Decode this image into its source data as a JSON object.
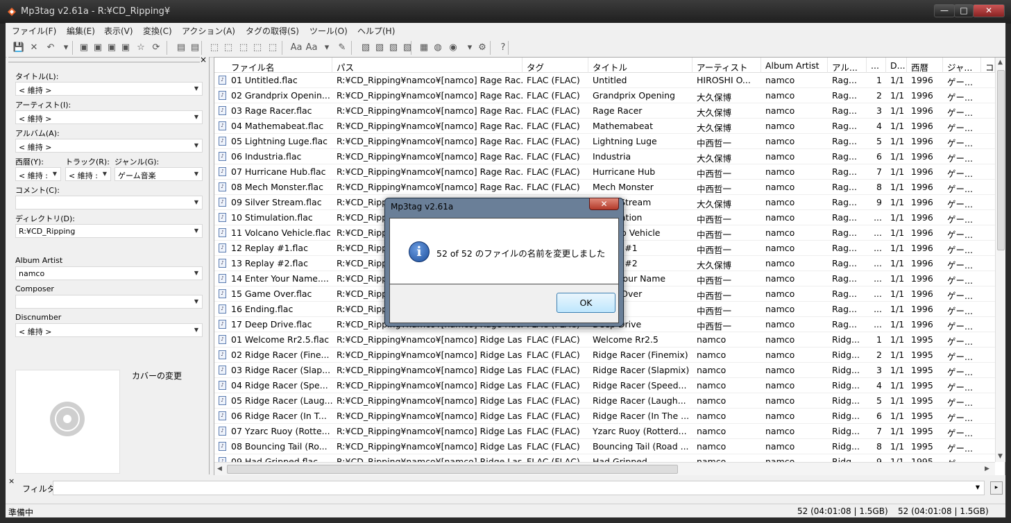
{
  "window": {
    "title": "Mp3tag v2.61a  -  R:¥CD_Ripping¥",
    "btn_min": "—",
    "btn_max": "□",
    "btn_close": "✕"
  },
  "menu": [
    "ファイル(F)",
    "編集(E)",
    "表示(V)",
    "変換(C)",
    "アクション(A)",
    "タグの取得(S)",
    "ツール(O)",
    "ヘルプ(H)"
  ],
  "tag_panel": {
    "close": "×",
    "title_label": "タイトル(L):",
    "title_value": "< 維持 >",
    "artist_label": "アーティスト(I):",
    "artist_value": "< 維持 >",
    "album_label": "アルバム(A):",
    "album_value": "< 維持 >",
    "year_label": "西暦(Y):",
    "year_value": "< 維持 :",
    "track_label": "トラック(R):",
    "track_value": "< 維持 :",
    "genre_label": "ジャンル(G):",
    "genre_value": "ゲーム音楽",
    "comment_label": "コメント(C):",
    "comment_value": "",
    "dir_label": "ディレクトリ(D):",
    "dir_value": "R:¥CD_Ripping",
    "albumartist_label": "Album Artist",
    "albumartist_value": "namco",
    "composer_label": "Composer",
    "composer_value": "",
    "discnumber_label": "Discnumber",
    "discnumber_value": "< 維持 >",
    "cover_label": "カバーの変更"
  },
  "columns": [
    "ファイル名",
    "パス",
    "タグ",
    "タイトル",
    "アーティスト",
    "Album Artist",
    "アル...",
    "...",
    "D...",
    "西暦",
    "ジャ...",
    "コ"
  ],
  "rows": [
    [
      "01 Untitled.flac",
      "R:¥CD_Ripping¥namco¥[namco] Rage Rac...",
      "FLAC (FLAC)",
      "Untitled",
      "HIROSHI O...",
      "namco",
      "Rag...",
      "1",
      "1/1",
      "1996",
      "ゲー..."
    ],
    [
      "02 Grandprix Openin...",
      "R:¥CD_Ripping¥namco¥[namco] Rage Rac...",
      "FLAC (FLAC)",
      "Grandprix Opening",
      "大久保博",
      "namco",
      "Rag...",
      "2",
      "1/1",
      "1996",
      "ゲー..."
    ],
    [
      "03 Rage Racer.flac",
      "R:¥CD_Ripping¥namco¥[namco] Rage Rac...",
      "FLAC (FLAC)",
      "Rage Racer",
      "大久保博",
      "namco",
      "Rag...",
      "3",
      "1/1",
      "1996",
      "ゲー..."
    ],
    [
      "04 Mathemabeat.flac",
      "R:¥CD_Ripping¥namco¥[namco] Rage Rac...",
      "FLAC (FLAC)",
      "Mathemabeat",
      "大久保博",
      "namco",
      "Rag...",
      "4",
      "1/1",
      "1996",
      "ゲー..."
    ],
    [
      "05 Lightning Luge.flac",
      "R:¥CD_Ripping¥namco¥[namco] Rage Rac...",
      "FLAC (FLAC)",
      "Lightning Luge",
      "中西哲一",
      "namco",
      "Rag...",
      "5",
      "1/1",
      "1996",
      "ゲー..."
    ],
    [
      "06 Industria.flac",
      "R:¥CD_Ripping¥namco¥[namco] Rage Rac...",
      "FLAC (FLAC)",
      "Industria",
      "大久保博",
      "namco",
      "Rag...",
      "6",
      "1/1",
      "1996",
      "ゲー..."
    ],
    [
      "07 Hurricane Hub.flac",
      "R:¥CD_Ripping¥namco¥[namco] Rage Rac...",
      "FLAC (FLAC)",
      "Hurricane Hub",
      "中西哲一",
      "namco",
      "Rag...",
      "7",
      "1/1",
      "1996",
      "ゲー..."
    ],
    [
      "08 Mech Monster.flac",
      "R:¥CD_Ripping¥namco¥[namco] Rage Rac...",
      "FLAC (FLAC)",
      "Mech Monster",
      "中西哲一",
      "namco",
      "Rag...",
      "8",
      "1/1",
      "1996",
      "ゲー..."
    ],
    [
      "09 Silver Stream.flac",
      "R:¥CD_Ripping¥namco¥[namco] Rage Rac...",
      "FLAC (FLAC)",
      "Silver Stream",
      "大久保博",
      "namco",
      "Rag...",
      "9",
      "1/1",
      "1996",
      "ゲー..."
    ],
    [
      "10 Stimulation.flac",
      "R:¥CD_Ripping¥namco¥[namco] Rage Rac...",
      "FLAC (FLAC)",
      "Stimulation",
      "中西哲一",
      "namco",
      "Rag...",
      "...",
      "1/1",
      "1996",
      "ゲー..."
    ],
    [
      "11 Volcano Vehicle.flac",
      "R:¥CD_Ripping¥namco¥[namco] Rage Rac...",
      "FLAC (FLAC)",
      "Volcano Vehicle",
      "中西哲一",
      "namco",
      "Rag...",
      "...",
      "1/1",
      "1996",
      "ゲー..."
    ],
    [
      "12 Replay #1.flac",
      "R:¥CD_Ripping¥namco¥[namco] Rage Rac...",
      "FLAC (FLAC)",
      "Replay #1",
      "中西哲一",
      "namco",
      "Rag...",
      "...",
      "1/1",
      "1996",
      "ゲー..."
    ],
    [
      "13 Replay #2.flac",
      "R:¥CD_Ripping¥namco¥[namco] Rage Rac...",
      "FLAC (FLAC)",
      "Replay #2",
      "大久保博",
      "namco",
      "Rag...",
      "...",
      "1/1",
      "1996",
      "ゲー..."
    ],
    [
      "14 Enter Your Name....",
      "R:¥CD_Ripping¥namco¥[namco] Rage Rac...",
      "FLAC (FLAC)",
      "Enter Your Name",
      "中西哲一",
      "namco",
      "Rag...",
      "...",
      "1/1",
      "1996",
      "ゲー..."
    ],
    [
      "15 Game Over.flac",
      "R:¥CD_Ripping¥namco¥[namco] Rage Rac...",
      "FLAC (FLAC)",
      "Game Over",
      "中西哲一",
      "namco",
      "Rag...",
      "...",
      "1/1",
      "1996",
      "ゲー..."
    ],
    [
      "16 Ending.flac",
      "R:¥CD_Ripping¥namco¥[namco] Rage Rac...",
      "FLAC (FLAC)",
      "Ending",
      "中西哲一",
      "namco",
      "Rag...",
      "...",
      "1/1",
      "1996",
      "ゲー..."
    ],
    [
      "17 Deep Drive.flac",
      "R:¥CD_Ripping¥namco¥[namco] Rage Rac...",
      "FLAC (FLAC)",
      "Deep Drive",
      "中西哲一",
      "namco",
      "Rag...",
      "...",
      "1/1",
      "1996",
      "ゲー..."
    ],
    [
      "01 Welcome Rr2.5.flac",
      "R:¥CD_Ripping¥namco¥[namco] Ridge Las...",
      "FLAC (FLAC)",
      "Welcome Rr2.5",
      "namco",
      "namco",
      "Ridg...",
      "1",
      "1/1",
      "1995",
      "ゲー..."
    ],
    [
      "02 Ridge Racer (Fine...",
      "R:¥CD_Ripping¥namco¥[namco] Ridge Las...",
      "FLAC (FLAC)",
      "Ridge Racer (Finemix)",
      "namco",
      "namco",
      "Ridg...",
      "2",
      "1/1",
      "1995",
      "ゲー..."
    ],
    [
      "03 Ridge Racer (Slap...",
      "R:¥CD_Ripping¥namco¥[namco] Ridge Las...",
      "FLAC (FLAC)",
      "Ridge Racer (Slapmix)",
      "namco",
      "namco",
      "Ridg...",
      "3",
      "1/1",
      "1995",
      "ゲー..."
    ],
    [
      "04 Ridge Racer (Spe...",
      "R:¥CD_Ripping¥namco¥[namco] Ridge Las...",
      "FLAC (FLAC)",
      "Ridge Racer (Speed...",
      "namco",
      "namco",
      "Ridg...",
      "4",
      "1/1",
      "1995",
      "ゲー..."
    ],
    [
      "05 Ridge Racer (Laug...",
      "R:¥CD_Ripping¥namco¥[namco] Ridge Las...",
      "FLAC (FLAC)",
      "Ridge Racer (Laugh...",
      "namco",
      "namco",
      "Ridg...",
      "5",
      "1/1",
      "1995",
      "ゲー..."
    ],
    [
      "06 Ridge Racer (In T...",
      "R:¥CD_Ripping¥namco¥[namco] Ridge Las...",
      "FLAC (FLAC)",
      "Ridge Racer (In The ...",
      "namco",
      "namco",
      "Ridg...",
      "6",
      "1/1",
      "1995",
      "ゲー..."
    ],
    [
      "07 Yzarc Ruoy (Rotte...",
      "R:¥CD_Ripping¥namco¥[namco] Ridge Las...",
      "FLAC (FLAC)",
      "Yzarc Ruoy (Rotterd...",
      "namco",
      "namco",
      "Ridg...",
      "7",
      "1/1",
      "1995",
      "ゲー..."
    ],
    [
      "08 Bouncing Tail (Ro...",
      "R:¥CD_Ripping¥namco¥[namco] Ridge Las...",
      "FLAC (FLAC)",
      "Bouncing Tail (Road ...",
      "namco",
      "namco",
      "Ridg...",
      "8",
      "1/1",
      "1995",
      "ゲー..."
    ],
    [
      "09 Had Gripped.flac",
      "R:¥CD_Ripping¥namco¥[namco] Ridge Las...",
      "FLAC (FLAC)",
      "Had Gripped",
      "namco",
      "namco",
      "Ridg...",
      "9",
      "1/1",
      "1995",
      "ゲー..."
    ]
  ],
  "filter": {
    "close": "×",
    "label": "フィルタ:",
    "value": "",
    "go": "▸"
  },
  "status": {
    "text": "準備中",
    "selected": "52 (04:01:08 | 1.5GB)",
    "total": "52 (04:01:08 | 1.5GB)"
  },
  "dialog": {
    "title": "Mp3tag v2.61a",
    "close": "✕",
    "icon_glyph": "i",
    "message": "52 of 52 のファイルの名前を変更しました",
    "ok_label": "OK"
  },
  "icons": [
    "save-icon",
    "delete-icon",
    "undo-icon",
    "folder-icon",
    "folder-add-icon",
    "refresh-icon",
    "favorite-icon",
    "copy-icon",
    "paste-icon",
    "tag-source-icon",
    "case-icon",
    "text-icon",
    "export-icon",
    "info-icon",
    "help-icon"
  ],
  "toolbar_glyphs": [
    "💾",
    "✕",
    "↶",
    "▾",
    "▣",
    "▣",
    "▣",
    "▣",
    "☆",
    "⟳",
    "▤",
    "▤",
    "⬚",
    "⬚",
    "⬚",
    "⬚",
    "⬚",
    "Aa",
    "Aa",
    "▾",
    "✎",
    "▧",
    "▧",
    "▧",
    "▧",
    "▦",
    "◍",
    "◉",
    "▾",
    "⚙",
    "?"
  ]
}
